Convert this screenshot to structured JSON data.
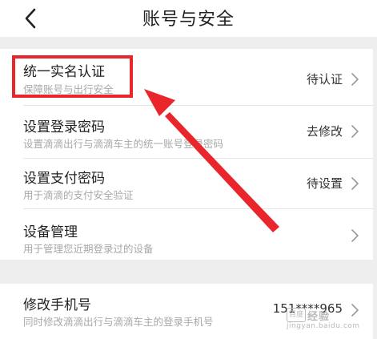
{
  "header": {
    "title": "账号与安全",
    "back_icon": "chevron-left-icon"
  },
  "security_items": [
    {
      "title": "统一实名认证",
      "subtitle": "保障账号与出行安全",
      "value": "待认证",
      "icon": "chevron-right-icon"
    },
    {
      "title": "设置登录密码",
      "subtitle": "设置滴滴出行与滴滴车主的统一账号登录密码",
      "value": "去修改",
      "icon": "chevron-right-icon"
    },
    {
      "title": "设置支付密码",
      "subtitle": "用于滴滴的支付安全验证",
      "value": "待设置",
      "icon": "chevron-right-icon"
    },
    {
      "title": "设备管理",
      "subtitle": "用于管理您近期登录过的设备",
      "value": "",
      "icon": "chevron-right-icon"
    }
  ],
  "phone_item": {
    "title": "修改手机号",
    "subtitle": "同时修改滴滴出行与滴滴车主的登录手机号",
    "value": "151****965",
    "icon": "chevron-right-icon"
  },
  "annotation": {
    "color": "#e8262b"
  },
  "watermark": {
    "mark": "百度",
    "text": "经验",
    "url": "jingyan.baidu.com"
  },
  "colors": {
    "background": "#ffffff",
    "section_gap": "#eeeeee",
    "title_text": "#222222",
    "subtitle_text": "#a8a8a8",
    "accent_annotation": "#e8262b"
  }
}
